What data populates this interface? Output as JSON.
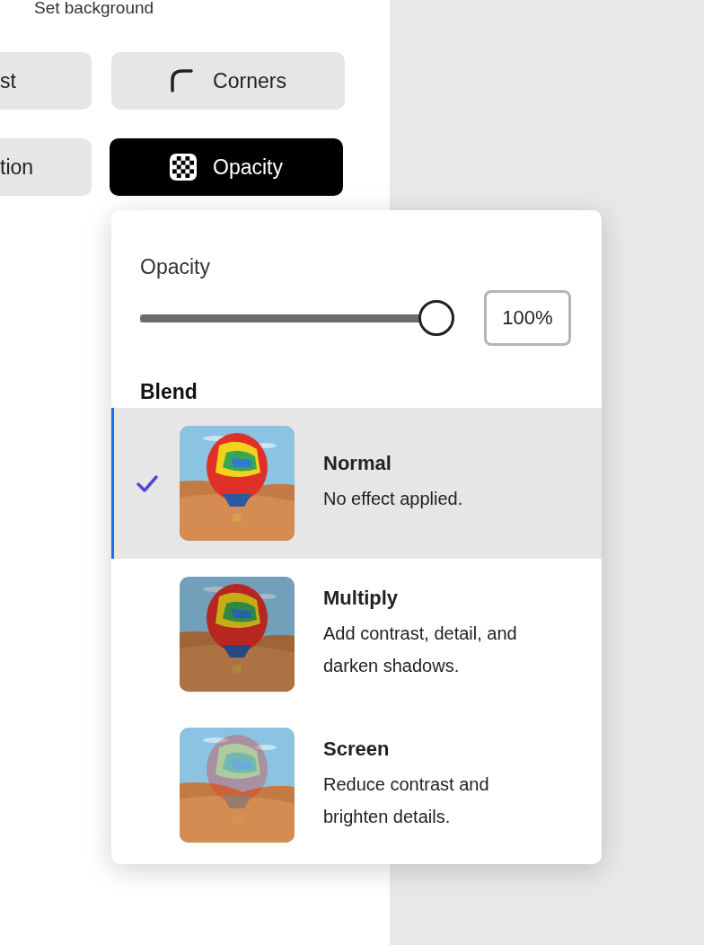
{
  "panel": {
    "heading": "Set background",
    "tools": [
      {
        "label": "st",
        "selected": false
      },
      {
        "label": "Corners",
        "selected": false
      },
      {
        "label": "tion",
        "selected": false
      },
      {
        "label": "Opacity",
        "selected": true
      }
    ]
  },
  "popover": {
    "opacity": {
      "label": "Opacity",
      "level": 1,
      "value": "100%"
    },
    "blend": {
      "label": "Blend",
      "modes": [
        {
          "name": "Normal",
          "description": "No effect applied.",
          "selected": true
        },
        {
          "name": "Multiply",
          "description": "Add contrast, detail, and darken shadows.",
          "selected": false
        },
        {
          "name": "Screen",
          "description": "Reduce contrast and brighten details.",
          "selected": false
        }
      ]
    }
  }
}
